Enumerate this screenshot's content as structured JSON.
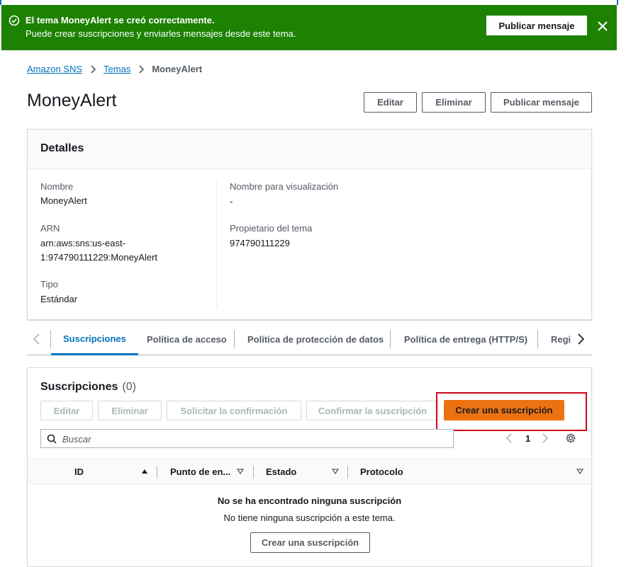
{
  "flash": {
    "title": "El tema MoneyAlert se creó correctamente.",
    "message": "Puede crear suscripciones y enviarles mensajes desde este tema.",
    "publish_label": "Publicar mensaje",
    "status_color": "#1d8102"
  },
  "breadcrumb": {
    "items": [
      "Amazon SNS",
      "Temas"
    ],
    "current": "MoneyAlert"
  },
  "page": {
    "title": "MoneyAlert",
    "edit_label": "Editar",
    "delete_label": "Eliminar",
    "publish_label": "Publicar mensaje"
  },
  "details": {
    "heading": "Detalles",
    "name_label": "Nombre",
    "name_value": "MoneyAlert",
    "arn_label": "ARN",
    "arn_value_line1": "arn:aws:sns:us-east-",
    "arn_value_line2": "1:974790111229:MoneyAlert",
    "type_label": "Tipo",
    "type_value": "Estándar",
    "display_name_label": "Nombre para visualización",
    "display_name_value": "-",
    "owner_label": "Propietario del tema",
    "owner_value": "974790111229"
  },
  "tabs": [
    {
      "label": "Suscripciones",
      "active": true
    },
    {
      "label": "Política de acceso",
      "active": false
    },
    {
      "label": "Política de protección de datos",
      "active": false
    },
    {
      "label": "Política de entrega (HTTP/S)",
      "active": false
    },
    {
      "label": "Regi",
      "active": false
    }
  ],
  "subscriptions": {
    "heading": "Suscripciones",
    "count": "(0)",
    "edit_label": "Editar",
    "delete_label": "Eliminar",
    "request_label": "Solicitar la confirmación",
    "confirm_label": "Confirmar la suscripción",
    "create_label": "Crear una suscripción",
    "search_placeholder": "Buscar",
    "page_number": "1",
    "columns": [
      "ID",
      "Punto de en...",
      "Estado",
      "Protocolo"
    ],
    "empty_title": "No se ha encontrado ninguna suscripción",
    "empty_message": "No tiene ninguna suscripción a este tema.",
    "empty_create_label": "Crear una suscripción",
    "accent_color": "#ec7211"
  }
}
